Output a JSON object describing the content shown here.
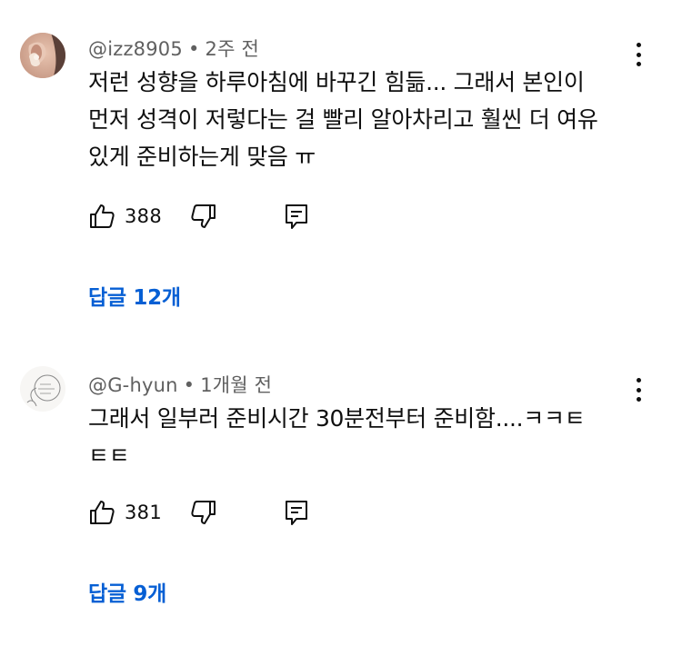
{
  "comments": [
    {
      "author": "@izz8905",
      "separator": "•",
      "time": "2주 전",
      "text_lines": [
        "저런 성향을 하루아침에 바꾸긴 힘듦... 그래서 본인이",
        "먼저 성격이 저렇다는 걸 빨리 알아차리고 훨씬 더 여유",
        "있게 준비하는게 맞음 ㅠ"
      ],
      "likes": "388",
      "replies_label": "답글 12개",
      "icons": {
        "avatar": "avatar-photo",
        "like": "thumbs-up-icon",
        "dislike": "thumbs-down-icon",
        "reply": "comment-reply-icon",
        "menu": "more-vertical-icon"
      }
    },
    {
      "author": "@G-hyun",
      "separator": "•",
      "time": "1개월 전",
      "text_lines": [
        "그래서 일부러 준비시간 30분전부터 준비함....ㅋㅋㅌ",
        "ㅌㅌ"
      ],
      "likes": "381",
      "replies_label": "답글 9개",
      "icons": {
        "avatar": "avatar-drawing",
        "like": "thumbs-up-icon",
        "dislike": "thumbs-down-icon",
        "reply": "comment-reply-icon",
        "menu": "more-vertical-icon"
      }
    }
  ],
  "colors": {
    "text": "#0f0f0f",
    "meta": "#606060",
    "link": "#065fd4",
    "background": "#ffffff"
  }
}
